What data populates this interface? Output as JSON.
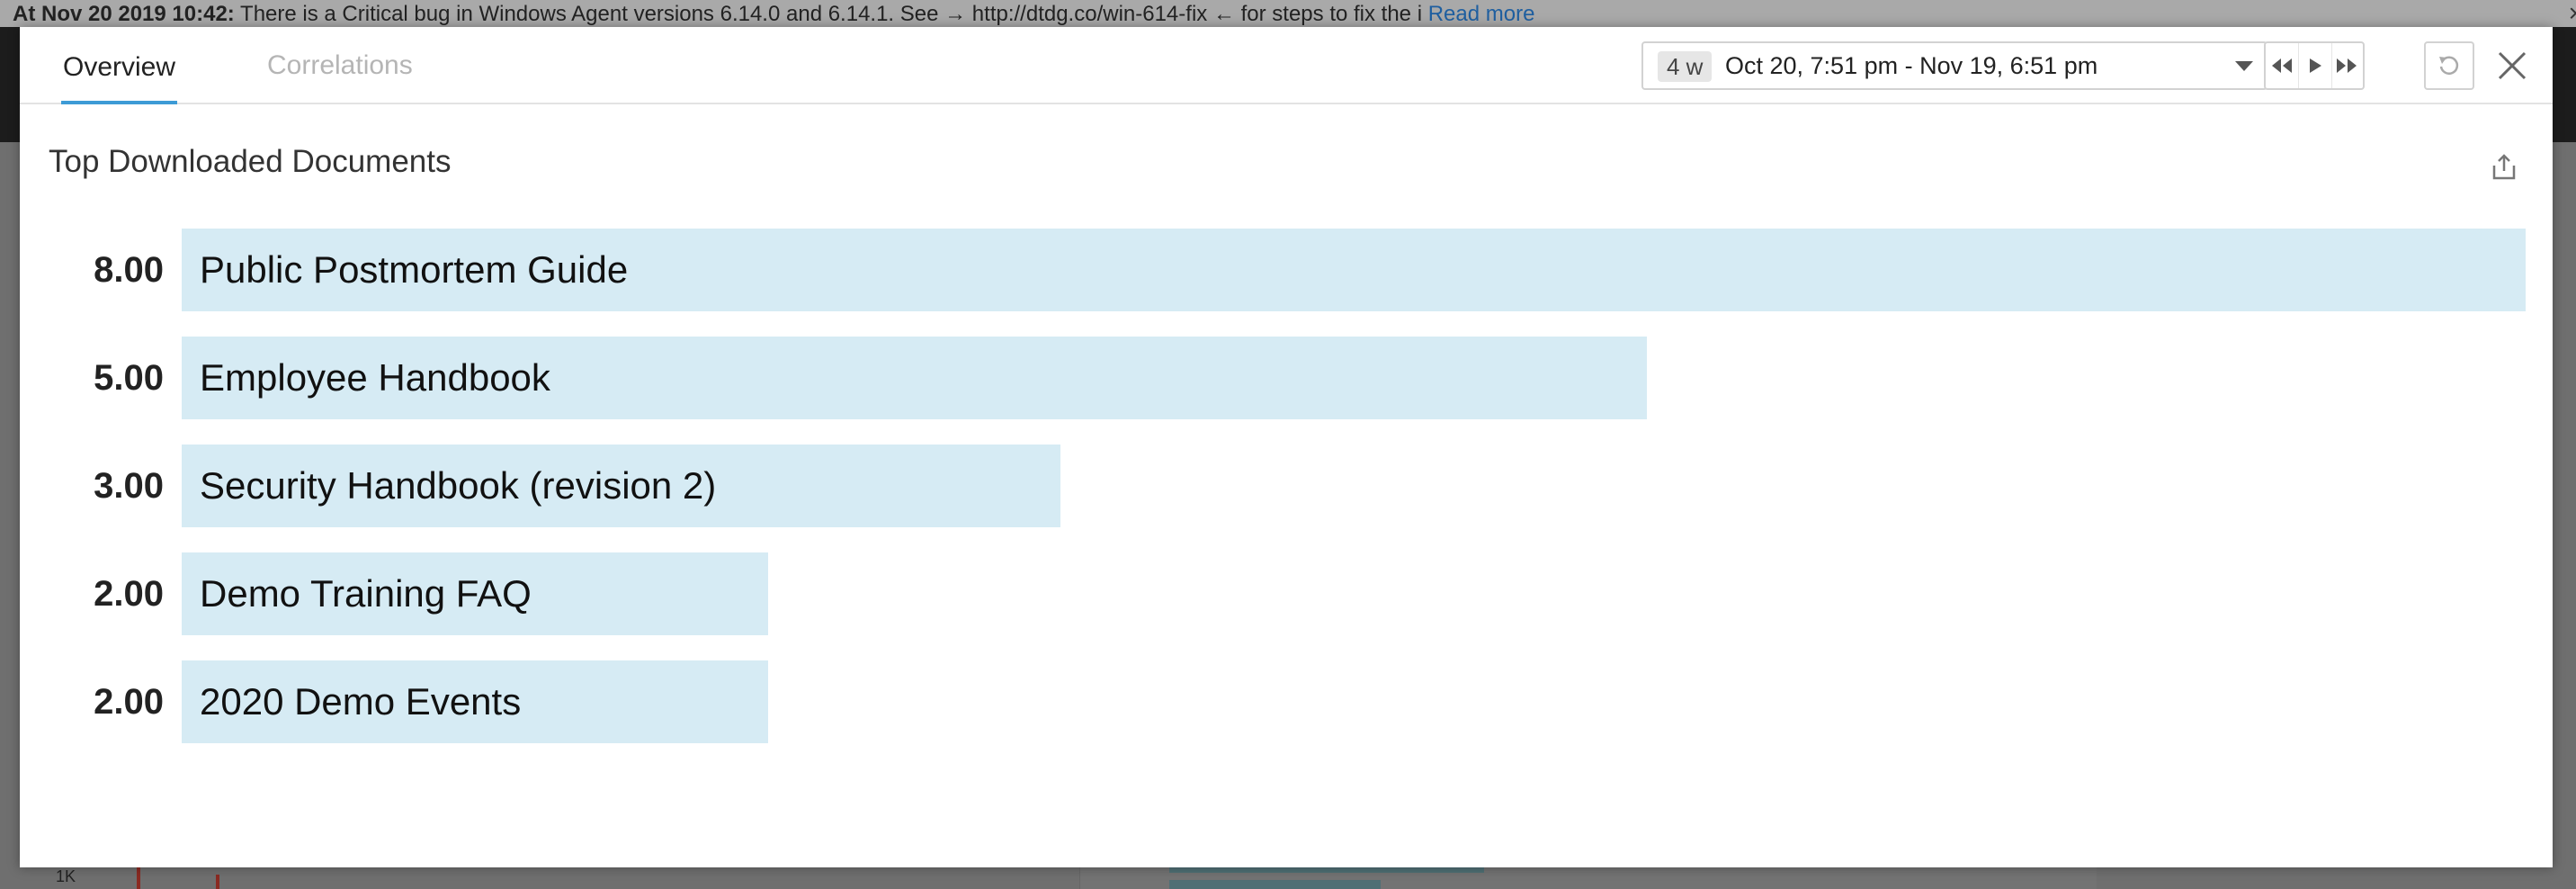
{
  "background": {
    "banner_prefix": "At Nov 20 2019 10:42:",
    "banner_text": " There is a Critical bug in Windows Agent versions 6.14.0 and 6.14.1. See → http://dtdg.co/win-614-fix ← for steps to fix the i",
    "banner_link": "Read more",
    "close": "×",
    "tick": "1K"
  },
  "tabs": [
    {
      "label": "Overview"
    },
    {
      "label": "Correlations"
    }
  ],
  "timepicker": {
    "badge": "4 w",
    "range": "Oct 20, 7:51 pm - Nov 19, 6:51 pm"
  },
  "widget": {
    "title": "Top Downloaded Documents"
  },
  "colors": {
    "bar": "#d6ebf4",
    "tab_active": "#3d9bd6"
  },
  "chart_data": {
    "type": "bar",
    "categories": [
      "Public Postmortem Guide",
      "Employee Handbook",
      "Security Handbook (revision 2)",
      "Demo Training FAQ",
      "2020 Demo Events"
    ],
    "values": [
      8,
      5,
      3,
      2,
      2
    ],
    "value_labels": [
      "8.00",
      "5.00",
      "3.00",
      "2.00",
      "2.00"
    ]
  }
}
